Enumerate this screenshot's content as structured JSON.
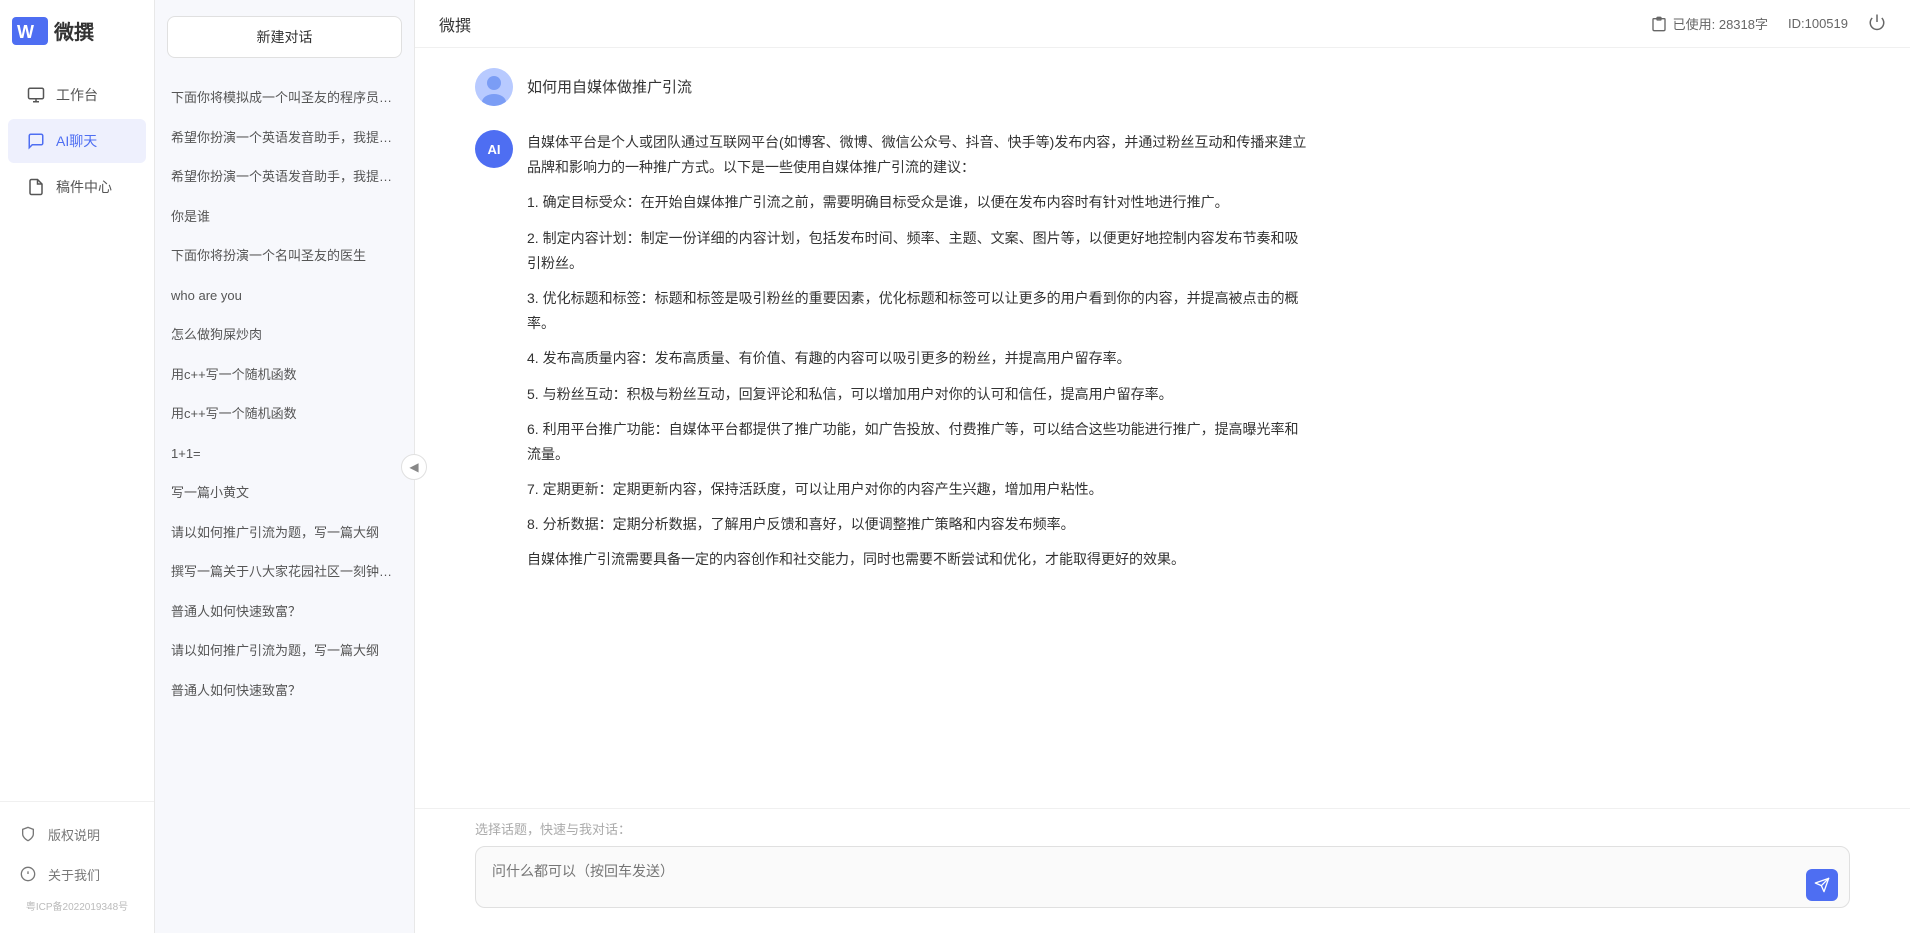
{
  "app": {
    "title": "微撰",
    "logo_letter": "W",
    "usage_label": "已使用: 28318字",
    "id_label": "ID:100519",
    "icp": "粤ICP备2022019348号"
  },
  "nav": {
    "items": [
      {
        "id": "workbench",
        "label": "工作台",
        "icon": "monitor"
      },
      {
        "id": "ai-chat",
        "label": "AI聊天",
        "icon": "chat",
        "active": true
      },
      {
        "id": "draft",
        "label": "稿件中心",
        "icon": "file"
      }
    ],
    "footer_items": [
      {
        "id": "copyright",
        "label": "版权说明",
        "icon": "shield"
      },
      {
        "id": "about",
        "label": "关于我们",
        "icon": "info"
      }
    ]
  },
  "history": {
    "new_chat_label": "新建对话",
    "items": [
      {
        "id": 1,
        "text": "下面你将模拟成一个叫圣友的程序员，我说..."
      },
      {
        "id": 2,
        "text": "希望你扮演一个英语发音助手，我提供给你..."
      },
      {
        "id": 3,
        "text": "希望你扮演一个英语发音助手，我提供给你..."
      },
      {
        "id": 4,
        "text": "你是谁",
        "active": true
      },
      {
        "id": 5,
        "text": "下面你将扮演一个名叫圣友的医生"
      },
      {
        "id": 6,
        "text": "who are you"
      },
      {
        "id": 7,
        "text": "怎么做狗屎炒肉"
      },
      {
        "id": 8,
        "text": "用c++写一个随机函数"
      },
      {
        "id": 9,
        "text": "用c++写一个随机函数"
      },
      {
        "id": 10,
        "text": "1+1="
      },
      {
        "id": 11,
        "text": "写一篇小黄文"
      },
      {
        "id": 12,
        "text": "请以如何推广引流为题，写一篇大纲"
      },
      {
        "id": 13,
        "text": "撰写一篇关于八大家花园社区一刻钟便民生..."
      },
      {
        "id": 14,
        "text": "普通人如何快速致富？"
      },
      {
        "id": 15,
        "text": "请以如何推广引流为题，写一篇大纲"
      },
      {
        "id": 16,
        "text": "普通人如何快速致富？"
      }
    ]
  },
  "chat": {
    "top_title": "微撰",
    "messages": [
      {
        "type": "user",
        "text": "如何用自媒体做推广引流"
      },
      {
        "type": "ai",
        "paragraphs": [
          "自媒体平台是个人或团队通过互联网平台(如博客、微博、微信公众号、抖音、快手等)发布内容，并通过粉丝互动和传播来建立品牌和影响力的一种推广方式。以下是一些使用自媒体推广引流的建议：",
          "1. 确定目标受众：在开始自媒体推广引流之前，需要明确目标受众是谁，以便在发布内容时有针对性地进行推广。",
          "2. 制定内容计划：制定一份详细的内容计划，包括发布时间、频率、主题、文案、图片等，以便更好地控制内容发布节奏和吸引粉丝。",
          "3. 优化标题和标签：标题和标签是吸引粉丝的重要因素，优化标题和标签可以让更多的用户看到你的内容，并提高被点击的概率。",
          "4. 发布高质量内容：发布高质量、有价值、有趣的内容可以吸引更多的粉丝，并提高用户留存率。",
          "5. 与粉丝互动：积极与粉丝互动，回复评论和私信，可以增加用户对你的认可和信任，提高用户留存率。",
          "6. 利用平台推广功能：自媒体平台都提供了推广功能，如广告投放、付费推广等，可以结合这些功能进行推广，提高曝光率和流量。",
          "7. 定期更新：定期更新内容，保持活跃度，可以让用户对你的内容产生兴趣，增加用户粘性。",
          "8. 分析数据：定期分析数据，了解用户反馈和喜好，以便调整推广策略和内容发布频率。",
          "自媒体推广引流需要具备一定的内容创作和社交能力，同时也需要不断尝试和优化，才能取得更好的效果。"
        ]
      }
    ],
    "quick_topics_label": "选择话题，快速与我对话：",
    "input_placeholder": "问什么都可以（按回车发送）"
  }
}
